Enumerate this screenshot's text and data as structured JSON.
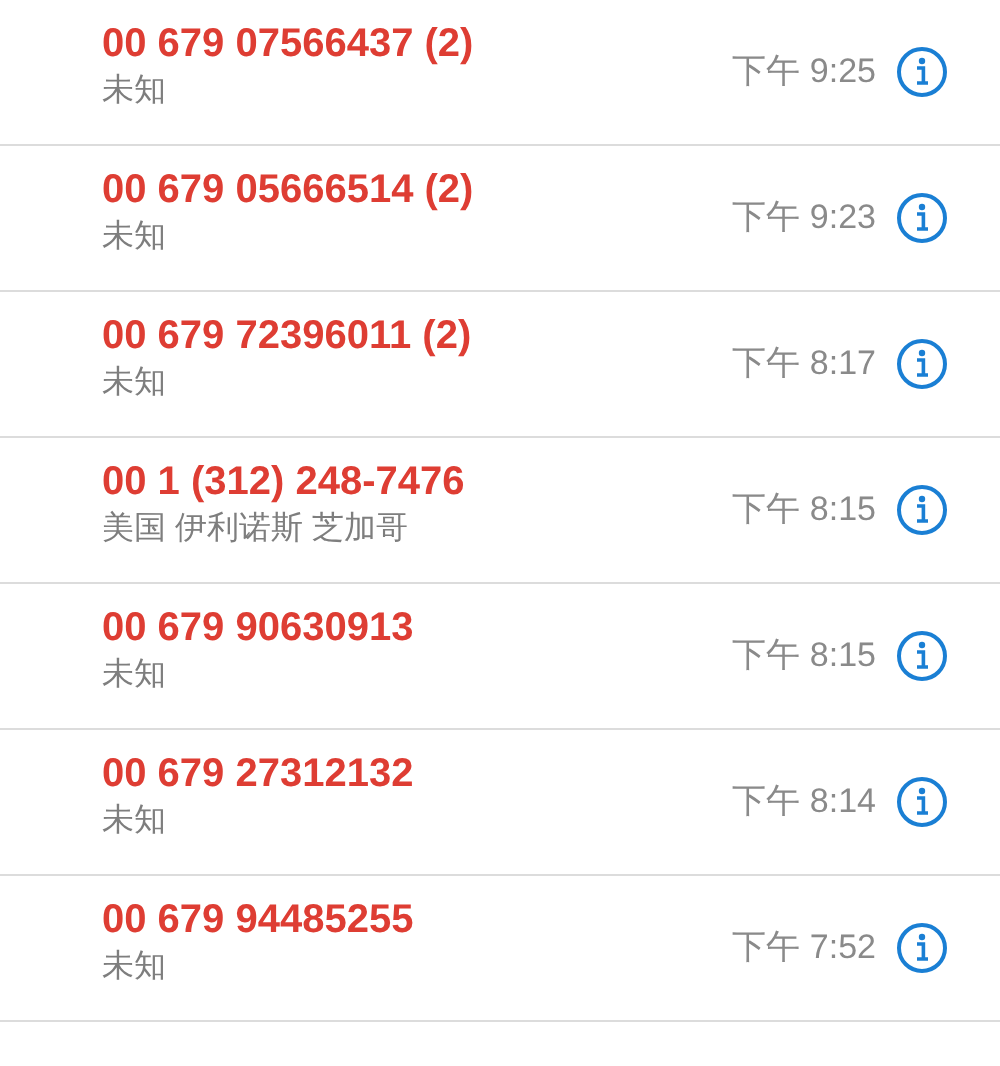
{
  "calls": [
    {
      "number": "00 679 07566437 (2)",
      "location": "未知",
      "time": "下午 9:25"
    },
    {
      "number": "00 679 05666514 (2)",
      "location": "未知",
      "time": "下午 9:23"
    },
    {
      "number": "00 679 72396011 (2)",
      "location": "未知",
      "time": "下午 8:17"
    },
    {
      "number": "00 1 (312) 248-7476",
      "location": "美国 伊利诺斯 芝加哥",
      "time": "下午 8:15"
    },
    {
      "number": "00 679 90630913",
      "location": "未知",
      "time": "下午 8:15"
    },
    {
      "number": "00 679 27312132",
      "location": "未知",
      "time": "下午 8:14"
    },
    {
      "number": "00 679 94485255",
      "location": "未知",
      "time": "下午 7:52"
    }
  ]
}
